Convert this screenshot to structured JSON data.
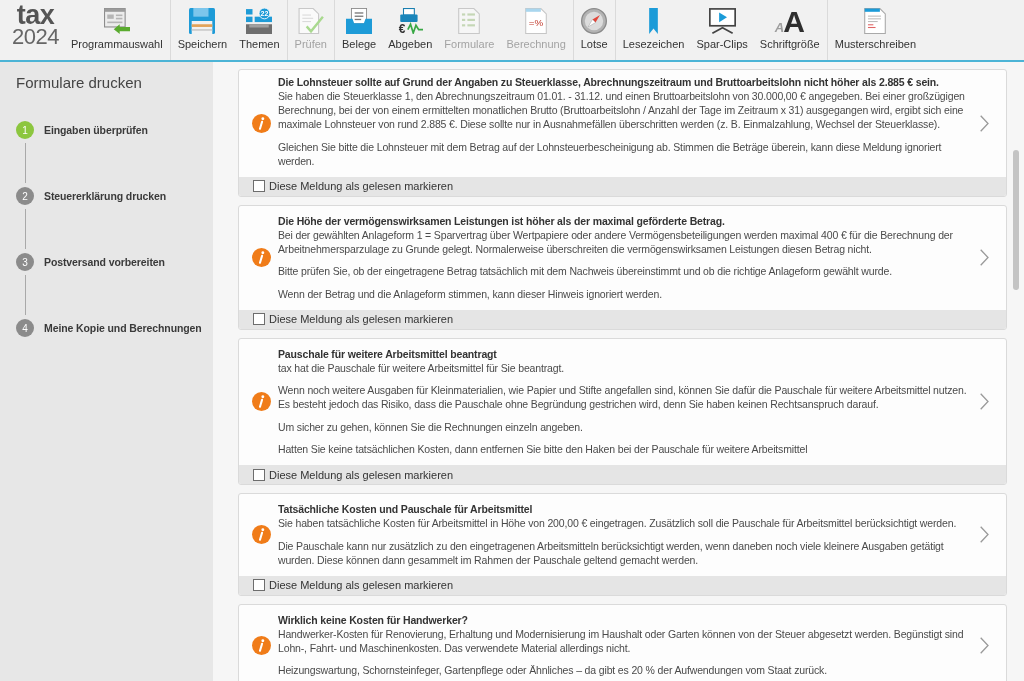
{
  "toolbar": {
    "logo": {
      "name": "tax",
      "year": "2024"
    },
    "groups": [
      [
        {
          "label": "Programmauswahl",
          "disabled": false
        }
      ],
      [
        {
          "label": "Speichern",
          "disabled": false
        },
        {
          "label": "Themen",
          "disabled": false,
          "icon_text": "22"
        }
      ],
      [
        {
          "label": "Prüfen",
          "disabled": true
        }
      ],
      [
        {
          "label": "Belege",
          "disabled": false
        },
        {
          "label": "Abgeben",
          "disabled": false,
          "icon_text": "€"
        },
        {
          "label": "Formulare",
          "disabled": true
        },
        {
          "label": "Berechnung",
          "disabled": true,
          "icon_text": "=%"
        }
      ],
      [
        {
          "label": "Lotse",
          "disabled": false
        }
      ],
      [
        {
          "label": "Lesezeichen",
          "disabled": false
        },
        {
          "label": "Spar-Clips",
          "disabled": false
        },
        {
          "label": "Schriftgröße",
          "disabled": false,
          "icon_letters": [
            "A",
            "A"
          ]
        }
      ],
      [
        {
          "label": "Musterschreiben",
          "disabled": false
        }
      ]
    ]
  },
  "sidebar": {
    "title": "Formulare drucken",
    "steps": [
      {
        "number": "1",
        "label": "Eingaben überprüfen",
        "selected": true
      },
      {
        "number": "2",
        "label": "Steuererklärung drucken",
        "selected": false
      },
      {
        "number": "3",
        "label": "Postversand vorbereiten",
        "selected": false
      },
      {
        "number": "4",
        "label": "Meine Kopie und Berechnungen",
        "selected": false
      }
    ]
  },
  "messages": [
    {
      "title": "Die Lohnsteuer sollte auf Grund der Angaben zu Steuerklasse, Abrechnungszeitraum und Bruttoarbeitslohn nicht höher als 2.885 € sein.",
      "paragraphs": [
        "Sie haben die Steuerklasse 1, den Abrechnungszeitraum 01.01. - 31.12. und einen Bruttoarbeitslohn von 30.000,00 € angegeben. Bei einer großzügigen Berechnung, bei der von einem ermittelten monatlichen Brutto (Bruttoarbeitslohn / Anzahl der Tage im Zeitraum x 31) ausgegangen wird, ergibt sich eine maximale Lohnsteuer von rund 2.885 €. Diese sollte nur in Ausnahmefällen überschritten werden (z. B. Einmalzahlung, Wechsel der Steuerklasse).",
        "Gleichen Sie bitte die Lohnsteuer mit dem Betrag auf der Lohnsteuerbescheinigung ab. Stimmen die Beträge überein, kann diese Meldung ignoriert werden."
      ],
      "checkbox": {
        "label": "Diese Meldung als gelesen markieren",
        "checked": false
      }
    },
    {
      "title": "Die Höhe der vermögenswirksamen Leistungen ist höher als der maximal geförderte Betrag.",
      "paragraphs": [
        "Bei der gewählten Anlageform 1 = Sparvertrag über Wertpapiere oder andere Vermögensbeteiligungen werden maximal 400 € für die Berechnung der Arbeitnehmersparzulage zu Grunde gelegt. Normalerweise überschreiten die vermögenswirksamen Leistungen diesen Betrag nicht.",
        "Bitte prüfen Sie, ob der eingetragene Betrag tatsächlich mit dem Nachweis übereinstimmt und ob die richtige Anlageform gewählt wurde.",
        "Wenn der Betrag und die Anlageform stimmen, kann dieser Hinweis ignoriert werden."
      ],
      "checkbox": {
        "label": "Diese Meldung als gelesen markieren",
        "checked": false
      }
    },
    {
      "title": "Pauschale für weitere Arbeitsmittel beantragt",
      "paragraphs": [
        "tax hat die Pauschale für weitere Arbeitsmittel für Sie beantragt.",
        "Wenn noch weitere Ausgaben für Kleinmaterialien, wie Papier und Stifte angefallen sind, können Sie dafür die Pauschale für weitere Arbeitsmittel nutzen. Es besteht jedoch das Risiko, dass die Pauschale ohne Begründung gestrichen wird, denn Sie haben keinen Rechtsanspruch darauf.",
        "Um sicher zu gehen, können Sie die Rechnungen einzeln angeben.",
        "Hatten Sie keine tatsächlichen Kosten, dann entfernen Sie bitte den Haken bei der Pauschale für weitere Arbeitsmittel"
      ],
      "checkbox": {
        "label": "Diese Meldung als gelesen markieren",
        "checked": false
      }
    },
    {
      "title": "Tatsächliche Kosten und Pauschale für Arbeitsmittel",
      "paragraphs": [
        "Sie haben tatsächliche Kosten für Arbeitsmittel in Höhe von 200,00 € eingetragen. Zusätzlich soll die Pauschale für Arbeitsmittel berücksichtigt werden.",
        "Die Pauschale kann nur zusätzlich zu den eingetragenen Arbeitsmitteln berücksichtigt werden, wenn daneben noch viele kleinere Ausgaben getätigt wurden. Diese können dann gesammelt im Rahmen der Pauschale geltend gemacht werden."
      ],
      "checkbox": {
        "label": "Diese Meldung als gelesen markieren",
        "checked": false
      }
    },
    {
      "title": "Wirklich keine Kosten für Handwerker?",
      "paragraphs": [
        "Handwerker-Kosten für Renovierung, Erhaltung und Modernisierung im Haushalt oder Garten können von der Steuer abgesetzt werden. Begünstigt sind Lohn-, Fahrt- und Maschinenkosten. Das verwendete Material allerdings nicht.",
        "Heizungswartung, Schornsteinfeger, Gartenpflege oder Ähnliches – da gibt es 20 % der Aufwendungen vom Staat zurück."
      ]
    }
  ]
}
